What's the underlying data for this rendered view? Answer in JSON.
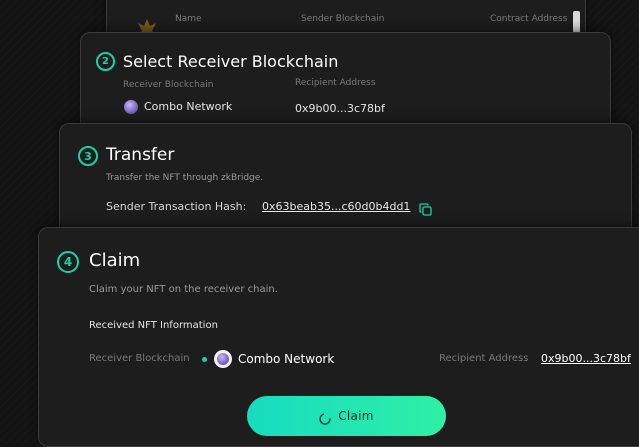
{
  "step1": {
    "col_name": "Name",
    "col_sender": "Sender Blockchain",
    "col_contract": "Contract Address",
    "nft_thumbnail_icon": "nft-image"
  },
  "step2": {
    "number": "2",
    "title": "Select Receiver Blockchain",
    "receiver_label": "Receiver Blockchain",
    "recipient_label": "Recipient Address",
    "network": "Combo Network",
    "address": "0x9b00...3c78bf"
  },
  "step3": {
    "number": "3",
    "title": "Transfer",
    "description": "Transfer the NFT through zkBridge.",
    "hash_label": "Sender Transaction Hash:",
    "hash_value": "0x63beab35...c60d0b4dd1",
    "copy_icon": "copy-icon"
  },
  "step4": {
    "number": "4",
    "title": "Claim",
    "description": "Claim your NFT on the receiver chain.",
    "info_heading": "Received NFT Information",
    "receiver_label": "Receiver Blockchain",
    "network": "Combo Network",
    "recipient_label": "Recipient Address",
    "address": "0x9b00...3c78bf",
    "claim_button": "Claim"
  },
  "colors": {
    "accent": "#19d3a5",
    "button_gradient_start": "#16dcc0",
    "button_gradient_end": "#2ef0a6"
  }
}
